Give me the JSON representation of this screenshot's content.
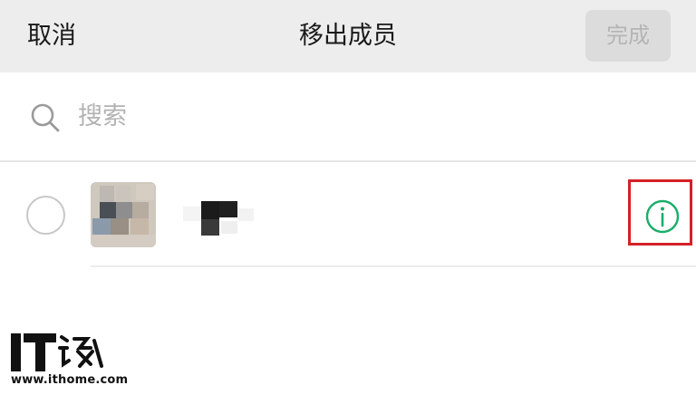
{
  "header": {
    "cancel_label": "取消",
    "title": "移出成员",
    "done_label": "完成"
  },
  "search": {
    "placeholder": "搜索",
    "value": ""
  },
  "members": [
    {
      "selected": false,
      "has_info": true
    }
  ],
  "watermark": {
    "brand": "IT之家",
    "site": "www.ithome.com"
  },
  "colors": {
    "header_bg": "#ededed",
    "done_disabled_bg": "#dcdcdc",
    "done_disabled_text": "#b4b4b4",
    "info_green": "#1aad6a",
    "highlight_red": "#d42127"
  },
  "icons": {
    "search": "search-icon",
    "info": "info-icon",
    "radio": "radio-unchecked-icon"
  }
}
